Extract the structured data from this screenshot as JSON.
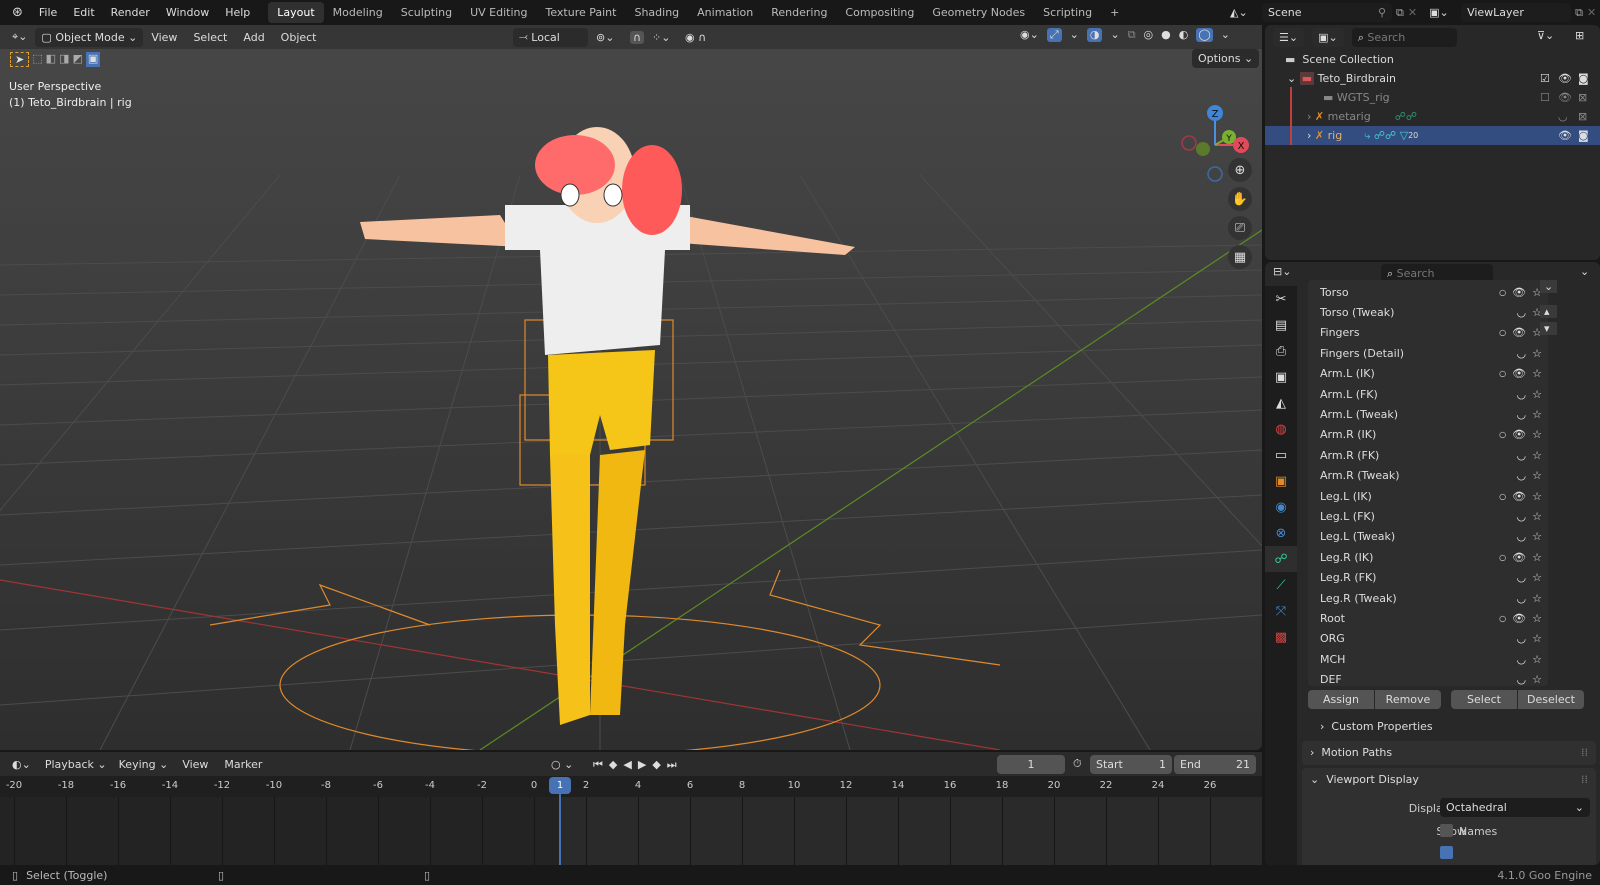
{
  "topbar": {
    "menus": [
      "File",
      "Edit",
      "Render",
      "Window",
      "Help"
    ],
    "workspaces": [
      "Layout",
      "Modeling",
      "Sculpting",
      "UV Editing",
      "Texture Paint",
      "Shading",
      "Animation",
      "Rendering",
      "Compositing",
      "Geometry Nodes",
      "Scripting"
    ],
    "active_workspace": "Layout",
    "add_workspace": "+",
    "scene": "Scene",
    "view_layer": "ViewLayer"
  },
  "viewport": {
    "mode": "Object Mode",
    "menus": [
      "View",
      "Select",
      "Add",
      "Object"
    ],
    "transform_orientation": "Local",
    "options": "Options",
    "overlay_title": "User Perspective",
    "overlay_object": "(1) Teto_Birdbrain | rig",
    "gizmo_axes": [
      "Z",
      "Y",
      "X"
    ]
  },
  "outliner": {
    "search_placeholder": "Search",
    "items": [
      {
        "label": "Scene Collection"
      },
      {
        "label": "Teto_Birdbrain"
      },
      {
        "label": "WGTS_rig"
      },
      {
        "label": "metarig"
      },
      {
        "label": "rig",
        "badge": "20"
      }
    ]
  },
  "properties": {
    "search_placeholder": "Search",
    "bone_collections": [
      {
        "name": "Torso",
        "visible": true
      },
      {
        "name": "Torso (Tweak)",
        "visible": false
      },
      {
        "name": "Fingers",
        "visible": true
      },
      {
        "name": "Fingers (Detail)",
        "visible": false
      },
      {
        "name": "Arm.L (IK)",
        "visible": true
      },
      {
        "name": "Arm.L (FK)",
        "visible": false
      },
      {
        "name": "Arm.L (Tweak)",
        "visible": false
      },
      {
        "name": "Arm.R (IK)",
        "visible": true
      },
      {
        "name": "Arm.R (FK)",
        "visible": false
      },
      {
        "name": "Arm.R (Tweak)",
        "visible": false
      },
      {
        "name": "Leg.L (IK)",
        "visible": true
      },
      {
        "name": "Leg.L (FK)",
        "visible": false
      },
      {
        "name": "Leg.L (Tweak)",
        "visible": false
      },
      {
        "name": "Leg.R (IK)",
        "visible": true
      },
      {
        "name": "Leg.R (FK)",
        "visible": false
      },
      {
        "name": "Leg.R (Tweak)",
        "visible": false
      },
      {
        "name": "Root",
        "visible": true
      },
      {
        "name": "ORG",
        "visible": false
      },
      {
        "name": "MCH",
        "visible": false
      },
      {
        "name": "DEF",
        "visible": false
      }
    ],
    "buttons": {
      "assign": "Assign",
      "remove": "Remove",
      "select": "Select",
      "deselect": "Deselect"
    },
    "custom_properties": "Custom Properties",
    "motion_paths": "Motion Paths",
    "viewport_display": "Viewport Display",
    "display_as_label": "Display As",
    "display_as_value": "Octahedral",
    "show_label": "Show",
    "names_label": "Names"
  },
  "timeline": {
    "menus": [
      "Playback",
      "Keying",
      "View",
      "Marker"
    ],
    "current_frame": "1",
    "start_label": "Start",
    "start": "1",
    "end_label": "End",
    "end": "21",
    "ticks": [
      -20,
      -18,
      -16,
      -14,
      -12,
      -10,
      -8,
      -6,
      -4,
      -2,
      0,
      2,
      4,
      6,
      8,
      10,
      12,
      14,
      16,
      18,
      20,
      22,
      24,
      26
    ]
  },
  "status": {
    "hint": "Select (Toggle)",
    "version": "4.1.0 Goo Engine"
  },
  "colors": {
    "accent": "#4772b3",
    "bone_orange": "#e08a2c",
    "x_axis": "#c33a3a",
    "y_axis": "#6a9a2a"
  }
}
